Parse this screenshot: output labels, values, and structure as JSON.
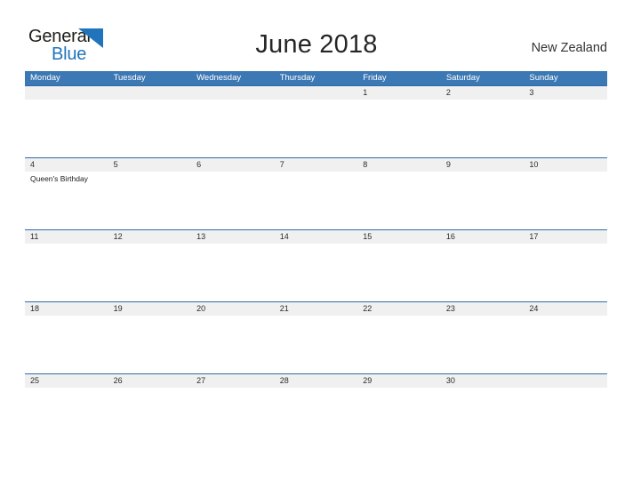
{
  "brand": {
    "name_part1": "General",
    "name_part2": "Blue",
    "logo_icon": "blue-triangle-icon",
    "color_dark": "#1d1d1b",
    "color_blue": "#1f74bb"
  },
  "header": {
    "title": "June 2018",
    "country": "New Zealand"
  },
  "theme": {
    "header_blue": "#3c78b4",
    "date_band_gray": "#f0f0f0",
    "row_border_blue": "#2f6ca6",
    "page_background": "#ffffff"
  },
  "calendar": {
    "month": "June",
    "year": "2018",
    "weekday_headers": [
      "Monday",
      "Tuesday",
      "Wednesday",
      "Thursday",
      "Friday",
      "Saturday",
      "Sunday"
    ],
    "weeks": [
      {
        "days": [
          {
            "date": "",
            "event": ""
          },
          {
            "date": "",
            "event": ""
          },
          {
            "date": "",
            "event": ""
          },
          {
            "date": "",
            "event": ""
          },
          {
            "date": "1",
            "event": ""
          },
          {
            "date": "2",
            "event": ""
          },
          {
            "date": "3",
            "event": ""
          }
        ]
      },
      {
        "days": [
          {
            "date": "4",
            "event": "Queen's Birthday"
          },
          {
            "date": "5",
            "event": ""
          },
          {
            "date": "6",
            "event": ""
          },
          {
            "date": "7",
            "event": ""
          },
          {
            "date": "8",
            "event": ""
          },
          {
            "date": "9",
            "event": ""
          },
          {
            "date": "10",
            "event": ""
          }
        ]
      },
      {
        "days": [
          {
            "date": "11",
            "event": ""
          },
          {
            "date": "12",
            "event": ""
          },
          {
            "date": "13",
            "event": ""
          },
          {
            "date": "14",
            "event": ""
          },
          {
            "date": "15",
            "event": ""
          },
          {
            "date": "16",
            "event": ""
          },
          {
            "date": "17",
            "event": ""
          }
        ]
      },
      {
        "days": [
          {
            "date": "18",
            "event": ""
          },
          {
            "date": "19",
            "event": ""
          },
          {
            "date": "20",
            "event": ""
          },
          {
            "date": "21",
            "event": ""
          },
          {
            "date": "22",
            "event": ""
          },
          {
            "date": "23",
            "event": ""
          },
          {
            "date": "24",
            "event": ""
          }
        ]
      },
      {
        "days": [
          {
            "date": "25",
            "event": ""
          },
          {
            "date": "26",
            "event": ""
          },
          {
            "date": "27",
            "event": ""
          },
          {
            "date": "28",
            "event": ""
          },
          {
            "date": "29",
            "event": ""
          },
          {
            "date": "30",
            "event": ""
          },
          {
            "date": "",
            "event": ""
          }
        ]
      }
    ]
  }
}
